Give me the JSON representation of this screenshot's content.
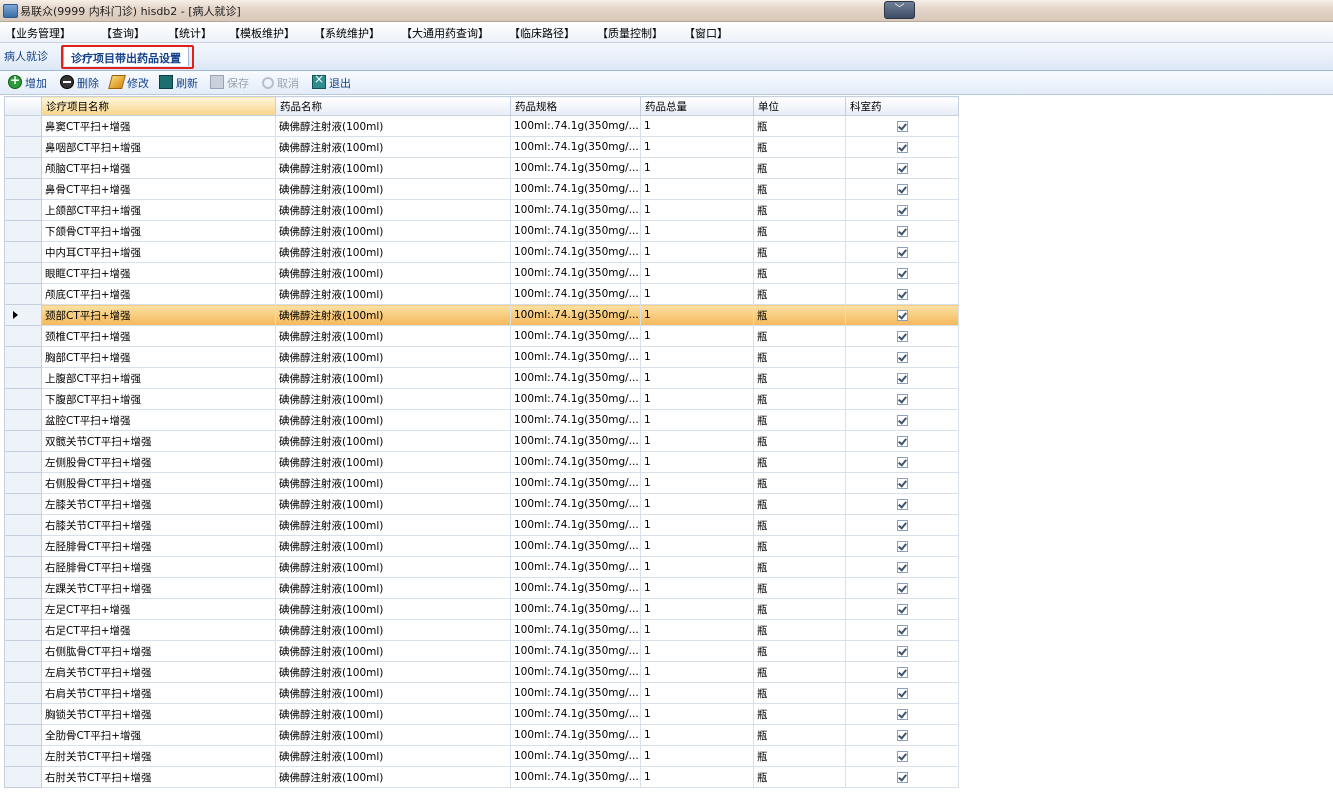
{
  "window": {
    "title": "易联众(9999 内科门诊) hisdb2 - [病人就诊]",
    "minimize_glyph": "﹀"
  },
  "menu": [
    "【业务管理】",
    "【查询】",
    "【统计】",
    "【模板维护】",
    "【系统维护】",
    "【大通用药查询】",
    "【临床路径】",
    "【质量控制】",
    "【窗口】"
  ],
  "tabs": {
    "patient": "病人就诊",
    "setting": "诊疗项目带出药品设置"
  },
  "toolbar": {
    "add": "增加",
    "delete": "删除",
    "edit": "修改",
    "refresh": "刷新",
    "save": "保存",
    "cancel": "取消",
    "exit": "退出"
  },
  "grid": {
    "columns": [
      "诊疗项目名称",
      "药品名称",
      "药品规格",
      "药品总量",
      "单位",
      "科室药"
    ],
    "selected_row": 9,
    "rows": [
      {
        "name": "鼻窦CT平扫+增强",
        "drug": "碘佛醇注射液(100ml)",
        "spec": "100ml:.74.1g(350mg/...",
        "qty": "1",
        "unit": "瓶",
        "dept": true
      },
      {
        "name": "鼻咽部CT平扫+增强",
        "drug": "碘佛醇注射液(100ml)",
        "spec": "100ml:.74.1g(350mg/...",
        "qty": "1",
        "unit": "瓶",
        "dept": true
      },
      {
        "name": "颅脑CT平扫+增强",
        "drug": "碘佛醇注射液(100ml)",
        "spec": "100ml:.74.1g(350mg/...",
        "qty": "1",
        "unit": "瓶",
        "dept": true
      },
      {
        "name": "鼻骨CT平扫+增强",
        "drug": "碘佛醇注射液(100ml)",
        "spec": "100ml:.74.1g(350mg/...",
        "qty": "1",
        "unit": "瓶",
        "dept": true
      },
      {
        "name": "上颌部CT平扫+增强",
        "drug": "碘佛醇注射液(100ml)",
        "spec": "100ml:.74.1g(350mg/...",
        "qty": "1",
        "unit": "瓶",
        "dept": true
      },
      {
        "name": "下颌骨CT平扫+增强",
        "drug": "碘佛醇注射液(100ml)",
        "spec": "100ml:.74.1g(350mg/...",
        "qty": "1",
        "unit": "瓶",
        "dept": true
      },
      {
        "name": "中内耳CT平扫+增强",
        "drug": "碘佛醇注射液(100ml)",
        "spec": "100ml:.74.1g(350mg/...",
        "qty": "1",
        "unit": "瓶",
        "dept": true
      },
      {
        "name": "眼眶CT平扫+增强",
        "drug": "碘佛醇注射液(100ml)",
        "spec": "100ml:.74.1g(350mg/...",
        "qty": "1",
        "unit": "瓶",
        "dept": true
      },
      {
        "name": "颅底CT平扫+增强",
        "drug": "碘佛醇注射液(100ml)",
        "spec": "100ml:.74.1g(350mg/...",
        "qty": "1",
        "unit": "瓶",
        "dept": true
      },
      {
        "name": "颈部CT平扫+增强",
        "drug": "碘佛醇注射液(100ml)",
        "spec": "100ml:.74.1g(350mg/...",
        "qty": "1",
        "unit": "瓶",
        "dept": true
      },
      {
        "name": "颈椎CT平扫+增强",
        "drug": "碘佛醇注射液(100ml)",
        "spec": "100ml:.74.1g(350mg/...",
        "qty": "1",
        "unit": "瓶",
        "dept": true
      },
      {
        "name": "胸部CT平扫+增强",
        "drug": "碘佛醇注射液(100ml)",
        "spec": "100ml:.74.1g(350mg/...",
        "qty": "1",
        "unit": "瓶",
        "dept": true
      },
      {
        "name": "上腹部CT平扫+增强",
        "drug": "碘佛醇注射液(100ml)",
        "spec": "100ml:.74.1g(350mg/...",
        "qty": "1",
        "unit": "瓶",
        "dept": true
      },
      {
        "name": "下腹部CT平扫+增强",
        "drug": "碘佛醇注射液(100ml)",
        "spec": "100ml:.74.1g(350mg/...",
        "qty": "1",
        "unit": "瓶",
        "dept": true
      },
      {
        "name": "盆腔CT平扫+增强",
        "drug": "碘佛醇注射液(100ml)",
        "spec": "100ml:.74.1g(350mg/...",
        "qty": "1",
        "unit": "瓶",
        "dept": true
      },
      {
        "name": "双髋关节CT平扫+增强",
        "drug": "碘佛醇注射液(100ml)",
        "spec": "100ml:.74.1g(350mg/...",
        "qty": "1",
        "unit": "瓶",
        "dept": true
      },
      {
        "name": "左侧股骨CT平扫+增强",
        "drug": "碘佛醇注射液(100ml)",
        "spec": "100ml:.74.1g(350mg/...",
        "qty": "1",
        "unit": "瓶",
        "dept": true
      },
      {
        "name": "右侧股骨CT平扫+增强",
        "drug": "碘佛醇注射液(100ml)",
        "spec": "100ml:.74.1g(350mg/...",
        "qty": "1",
        "unit": "瓶",
        "dept": true
      },
      {
        "name": "左膝关节CT平扫+增强",
        "drug": "碘佛醇注射液(100ml)",
        "spec": "100ml:.74.1g(350mg/...",
        "qty": "1",
        "unit": "瓶",
        "dept": true
      },
      {
        "name": "右膝关节CT平扫+增强",
        "drug": "碘佛醇注射液(100ml)",
        "spec": "100ml:.74.1g(350mg/...",
        "qty": "1",
        "unit": "瓶",
        "dept": true
      },
      {
        "name": "左胫腓骨CT平扫+增强",
        "drug": "碘佛醇注射液(100ml)",
        "spec": "100ml:.74.1g(350mg/...",
        "qty": "1",
        "unit": "瓶",
        "dept": true
      },
      {
        "name": "右胫腓骨CT平扫+增强",
        "drug": "碘佛醇注射液(100ml)",
        "spec": "100ml:.74.1g(350mg/...",
        "qty": "1",
        "unit": "瓶",
        "dept": true
      },
      {
        "name": "左踝关节CT平扫+增强",
        "drug": "碘佛醇注射液(100ml)",
        "spec": "100ml:.74.1g(350mg/...",
        "qty": "1",
        "unit": "瓶",
        "dept": true
      },
      {
        "name": "左足CT平扫+增强",
        "drug": "碘佛醇注射液(100ml)",
        "spec": "100ml:.74.1g(350mg/...",
        "qty": "1",
        "unit": "瓶",
        "dept": true
      },
      {
        "name": "右足CT平扫+增强",
        "drug": "碘佛醇注射液(100ml)",
        "spec": "100ml:.74.1g(350mg/...",
        "qty": "1",
        "unit": "瓶",
        "dept": true
      },
      {
        "name": "右侧肱骨CT平扫+增强",
        "drug": "碘佛醇注射液(100ml)",
        "spec": "100ml:.74.1g(350mg/...",
        "qty": "1",
        "unit": "瓶",
        "dept": true
      },
      {
        "name": "左肩关节CT平扫+增强",
        "drug": "碘佛醇注射液(100ml)",
        "spec": "100ml:.74.1g(350mg/...",
        "qty": "1",
        "unit": "瓶",
        "dept": true
      },
      {
        "name": "右肩关节CT平扫+增强",
        "drug": "碘佛醇注射液(100ml)",
        "spec": "100ml:.74.1g(350mg/...",
        "qty": "1",
        "unit": "瓶",
        "dept": true
      },
      {
        "name": "胸锁关节CT平扫+增强",
        "drug": "碘佛醇注射液(100ml)",
        "spec": "100ml:.74.1g(350mg/...",
        "qty": "1",
        "unit": "瓶",
        "dept": true
      },
      {
        "name": "全肋骨CT平扫+增强",
        "drug": "碘佛醇注射液(100ml)",
        "spec": "100ml:.74.1g(350mg/...",
        "qty": "1",
        "unit": "瓶",
        "dept": true
      },
      {
        "name": "左肘关节CT平扫+增强",
        "drug": "碘佛醇注射液(100ml)",
        "spec": "100ml:.74.1g(350mg/...",
        "qty": "1",
        "unit": "瓶",
        "dept": true
      },
      {
        "name": "右肘关节CT平扫+增强",
        "drug": "碘佛醇注射液(100ml)",
        "spec": "100ml:.74.1g(350mg/...",
        "qty": "1",
        "unit": "瓶",
        "dept": true
      }
    ]
  }
}
